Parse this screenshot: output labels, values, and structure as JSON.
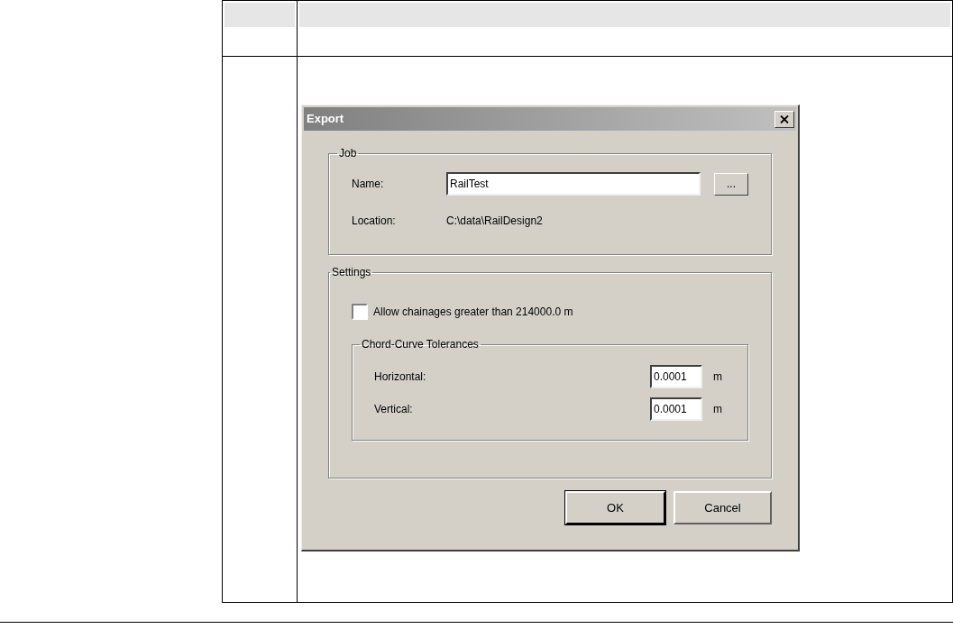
{
  "dialog": {
    "title": "Export",
    "job_group": {
      "title": "Job",
      "name_label": "Name:",
      "name_value": "RailTest",
      "browse_button": "...",
      "location_label": "Location:",
      "location_value": "C:\\data\\RailDesign2"
    },
    "settings_group": {
      "title": "Settings",
      "allow_checkbox": {
        "label": "Allow chainages greater than 214000.0 m",
        "checked": false
      },
      "tolerances_group": {
        "title": "Chord-Curve Tolerances",
        "fields": [
          {
            "label": "Horizontal:",
            "value": "0.0001",
            "unit": "m"
          },
          {
            "label": "Vertical:",
            "value": "0.0001",
            "unit": "m"
          }
        ]
      }
    },
    "buttons": [
      {
        "label": "OK",
        "default": true
      },
      {
        "label": "Cancel",
        "default": false
      }
    ]
  }
}
